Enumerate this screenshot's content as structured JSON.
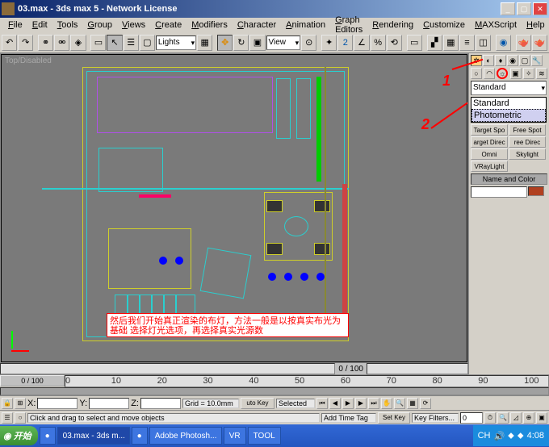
{
  "titlebar": {
    "text": "03.max - 3ds max 5 - Network License"
  },
  "menus": [
    "File",
    "Edit",
    "Tools",
    "Group",
    "Views",
    "Create",
    "Modifiers",
    "Character",
    "Animation",
    "Graph Editors",
    "Rendering",
    "Customize",
    "MAXScript",
    "Help"
  ],
  "toolbar": {
    "dropdown1": "Lights",
    "dropdown2": "View"
  },
  "viewport": {
    "label": "Top/Disabled",
    "note": "然后我们开始真正渲染的布灯，方法一般是以按真实布光为基础\n选择灯光选项，再选择真实光源数"
  },
  "scroll_info": "0 / 100",
  "side": {
    "main_dd": "Standard",
    "dd_options": [
      "Standard",
      "Photometric"
    ],
    "light_buttons": [
      "Target Spo",
      "Free Spot",
      "arget Direc",
      "ree Direc",
      "Omni",
      "Skylight",
      "VRayLight"
    ],
    "rollout": "Name and Color"
  },
  "annotations": {
    "one": "1",
    "two": "2"
  },
  "timeline": {
    "slider": "0 / 100",
    "ticks": [
      "0",
      "10",
      "20",
      "30",
      "40",
      "50",
      "60",
      "70",
      "80",
      "90",
      "100"
    ]
  },
  "status": {
    "x": "",
    "y": "",
    "z": "",
    "grid": "Grid = 10.0mm",
    "prompt": "Click and drag to select and move objects",
    "tag": "Add Time Tag",
    "autokey": "uto Key",
    "setkey": "Set Key",
    "selected": "Selected",
    "keyfilters": "Key Filters..."
  },
  "taskbar": {
    "start": "开始",
    "items": [
      "",
      "03.max - 3ds m...",
      "",
      "Adobe Photosh...",
      "VR",
      "TOOL"
    ],
    "lang": "CH",
    "time": "4:08"
  }
}
